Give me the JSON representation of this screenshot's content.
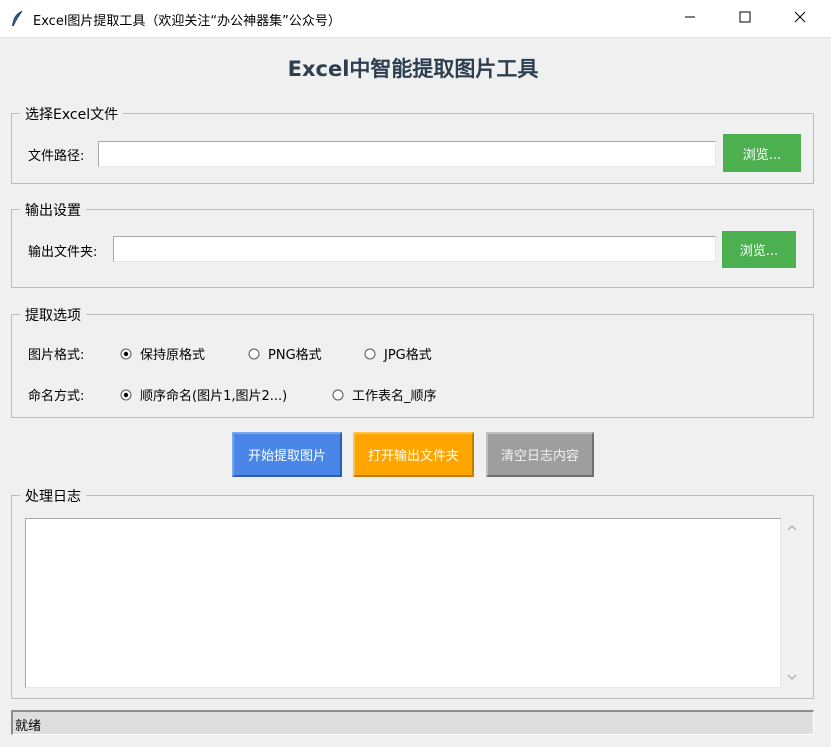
{
  "window": {
    "title": "Excel图片提取工具（欢迎关注“办公神器集”公众号）",
    "icon": "feather-icon",
    "controls": [
      "minimize-icon",
      "maximize-icon",
      "close-icon"
    ]
  },
  "heading": "Excel中智能提取图片工具",
  "file_group": {
    "title": "选择Excel文件",
    "label": "文件路径:",
    "value": "",
    "browse_label": "浏览..."
  },
  "output_group": {
    "title": "输出设置",
    "label": "输出文件夹:",
    "value": "",
    "browse_label": "浏览..."
  },
  "options_group": {
    "title": "提取选项",
    "format_label": "图片格式:",
    "format_options": [
      "保持原格式",
      "PNG格式",
      "JPG格式"
    ],
    "format_selected": "保持原格式",
    "naming_label": "命名方式:",
    "naming_options": [
      "顺序命名(图片1,图片2...)",
      "工作表名_顺序"
    ],
    "naming_selected": "顺序命名(图片1,图片2...)"
  },
  "actions": {
    "start_label": "开始提取图片",
    "open_label": "打开输出文件夹",
    "clear_label": "清空日志内容"
  },
  "log_group": {
    "title": "处理日志",
    "content": ""
  },
  "status": "就绪",
  "colors": {
    "heading": "#2c3e50",
    "browse_button": "#4caf50",
    "start_button": "#4a86e8",
    "open_button": "#ffa500",
    "clear_button": "#9e9e9e"
  }
}
